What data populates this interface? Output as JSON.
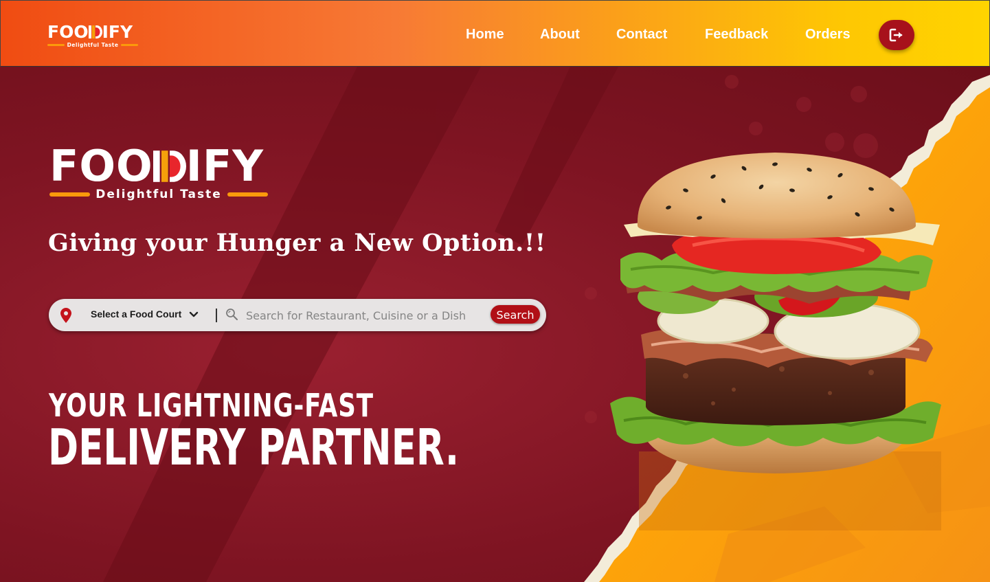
{
  "brand": {
    "logo_text": "FOODIFY",
    "logo_prefix": "FOO",
    "logo_suffix": "IFY",
    "tagline": "Delightful Taste"
  },
  "nav": {
    "links": [
      "Home",
      "About",
      "Contact",
      "Feedback",
      "Orders"
    ],
    "logout_icon": "logout-icon"
  },
  "hero": {
    "headline": "Giving your Hunger a New Option.!!",
    "tagline_line1": "YOUR LIGHTNING-FAST",
    "tagline_line2": "DELIVERY PARTNER."
  },
  "search": {
    "location_label": "Select a Food Court",
    "placeholder": "Search for Restaurant, Cuisine or a Dish",
    "value": "",
    "button_label": "Search",
    "icons": [
      "location-pin-icon",
      "chevron-down-icon",
      "magnifier-icon"
    ]
  },
  "colors": {
    "nav_gradient_start": "#f04c12",
    "nav_gradient_end": "#ffd400",
    "hero_red": "#7e1422",
    "accent_orange": "#fb9a0b",
    "button_red": "#b10f16"
  }
}
